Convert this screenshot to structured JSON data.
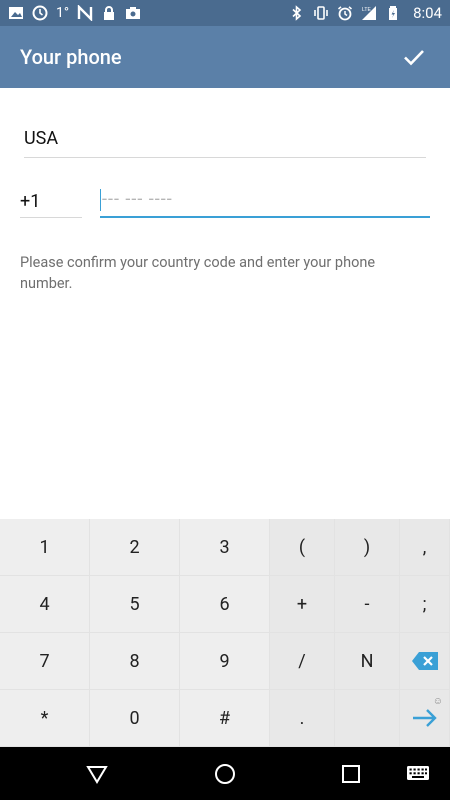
{
  "status_bar": {
    "temperature": "1°",
    "time": "8:04",
    "icons_left": [
      "image-icon",
      "clock-icon",
      "n-icon",
      "lock-icon",
      "camera-icon"
    ],
    "icons_right": [
      "bluetooth-icon",
      "vibrate-icon",
      "alarm-icon",
      "signal-lte-icon",
      "battery-icon"
    ],
    "network": "LTE"
  },
  "app_bar": {
    "title": "Your phone",
    "action_icon": "check-icon",
    "color": "#5b80a8"
  },
  "form": {
    "country": "USA",
    "country_code": "+1",
    "phone_value": "",
    "phone_placeholder": "--- --- ----",
    "hint": "Please confirm your country code and enter your phone number.",
    "accent_color": "#3aa0d6"
  },
  "keyboard": {
    "rows": [
      [
        "1",
        "2",
        "3",
        "(",
        ")",
        ","
      ],
      [
        "4",
        "5",
        "6",
        "+",
        "-",
        ";"
      ],
      [
        "7",
        "8",
        "9",
        "/",
        "N",
        "backspace-icon"
      ],
      [
        "*",
        "0",
        "#",
        ".",
        "",
        "enter-icon"
      ]
    ],
    "backspace_color": "#3aa0d6",
    "enter_color": "#3aa0d6"
  },
  "nav_bar": {
    "buttons": [
      "back-icon",
      "home-icon",
      "recents-icon",
      "keyboard-icon"
    ]
  }
}
